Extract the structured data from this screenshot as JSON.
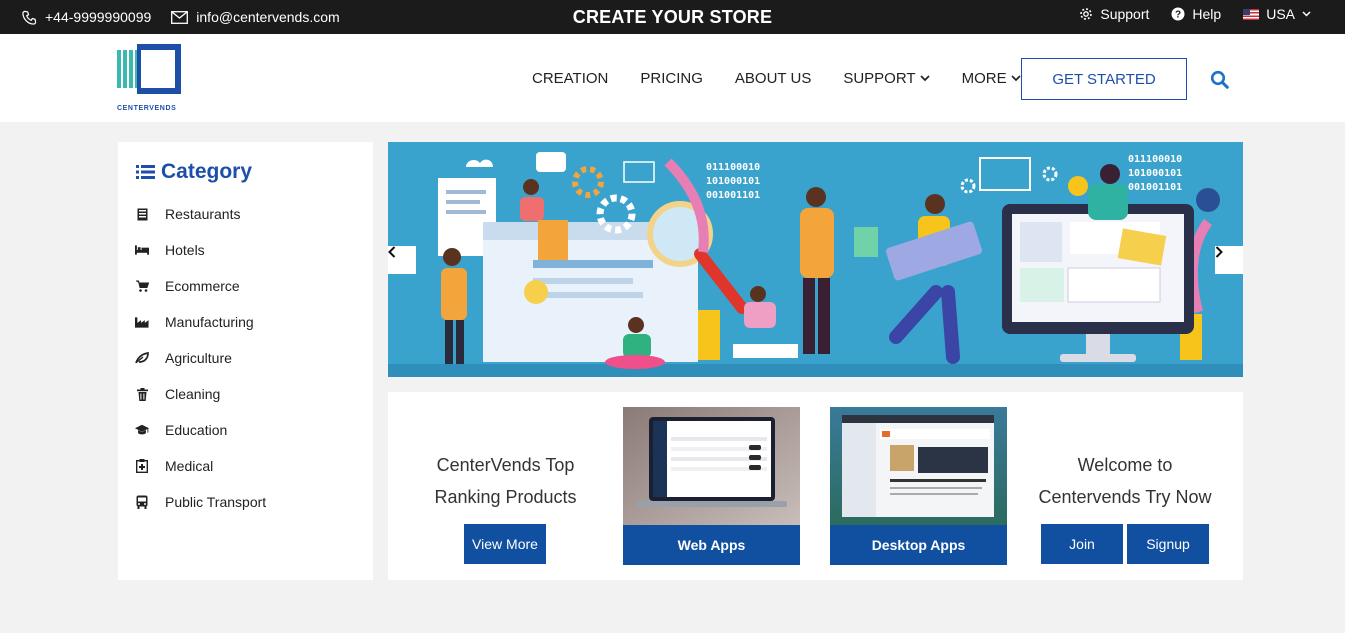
{
  "topbar": {
    "phone": "+44-9999990099",
    "email": "info@centervends.com",
    "promo": "CREATE YOUR STORE",
    "support": "Support",
    "help": "Help",
    "country": "USA"
  },
  "brand": {
    "name": "CENTERVENDS"
  },
  "nav": {
    "items": [
      "CREATION",
      "PRICING",
      "ABOUT US",
      "SUPPORT",
      "MORE"
    ],
    "cta": "GET STARTED"
  },
  "sidebar": {
    "title": "Category",
    "items": [
      {
        "label": "Restaurants",
        "icon": "restaurant-icon"
      },
      {
        "label": "Hotels",
        "icon": "bed-icon"
      },
      {
        "label": "Ecommerce",
        "icon": "cart-icon"
      },
      {
        "label": "Manufacturing",
        "icon": "factory-icon"
      },
      {
        "label": "Agriculture",
        "icon": "leaf-icon"
      },
      {
        "label": "Cleaning",
        "icon": "trash-icon"
      },
      {
        "label": "Education",
        "icon": "graduation-cap-icon"
      },
      {
        "label": "Medical",
        "icon": "medical-icon"
      },
      {
        "label": "Public Transport",
        "icon": "bus-icon"
      }
    ]
  },
  "hero": {
    "binary_left": [
      "011100010",
      "101000101",
      "001001101"
    ],
    "binary_right": [
      "011100010",
      "101000101",
      "001001101"
    ]
  },
  "promo": {
    "left_line1": "CenterVends Top",
    "left_line2": "Ranking Products",
    "view_more": "View More",
    "web_apps": "Web Apps",
    "desktop_apps": "Desktop Apps",
    "right_line1": "Welcome to",
    "right_line2": "Centervends Try Now",
    "join": "Join",
    "signup": "Signup"
  },
  "colors": {
    "brand_blue": "#1e4fa8",
    "button_blue": "#1150a0",
    "hero_bg": "#3aa3cd",
    "logo_teal": "#3bb8b0"
  }
}
